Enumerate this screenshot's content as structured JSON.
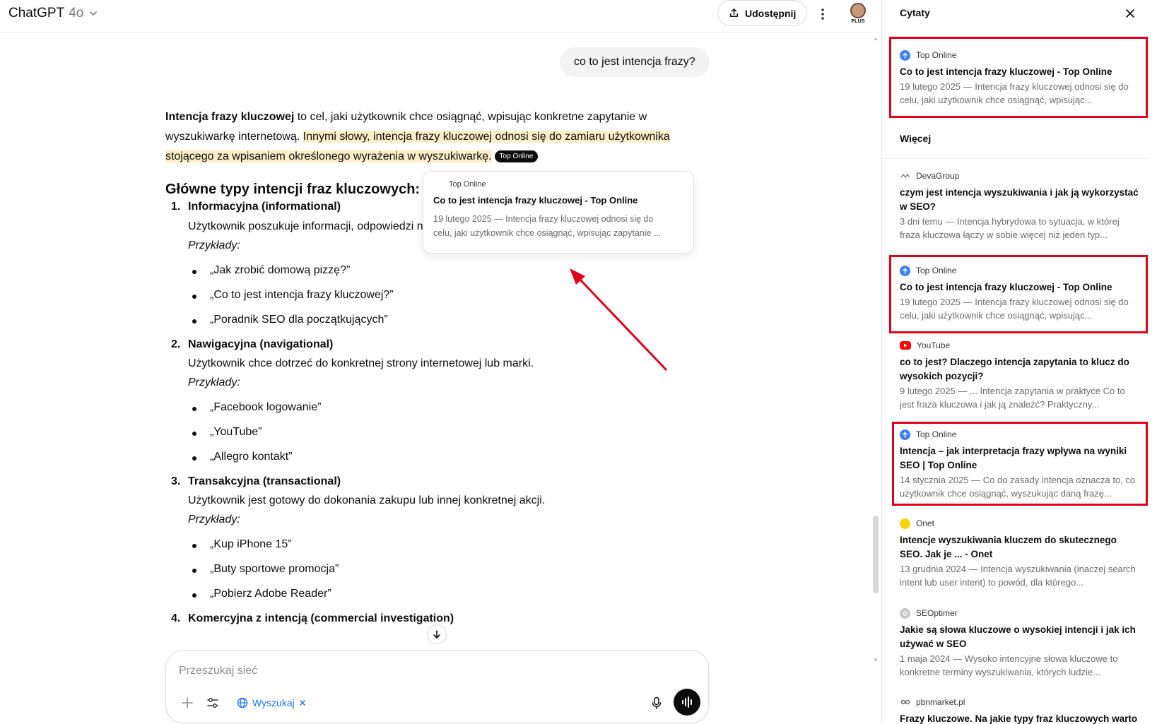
{
  "header": {
    "model_name": "ChatGPT",
    "model_version": "4o",
    "share_label": "Udostępnij",
    "avatar_badge": "PLUS"
  },
  "chat": {
    "user_message": "co to jest intencja frazy?",
    "intro_bold": "Intencja frazy kluczowej",
    "intro_rest": " to cel, jaki użytkownik chce osiągnąć, wpisując konkretne zapytanie w wyszukiwarkę internetową. ",
    "intro_highlight": "Innymi słowy, intencja frazy kluczowej odnosi się do zamiaru użytkownika stojącego za wpisaniem określonego wyrażenia w wyszukiwarkę.",
    "cite_pill": "Top Online",
    "section_title": "Główne typy intencji fraz kluczowych:",
    "examples_label": "Przykłady:",
    "items": [
      {
        "num": "1.",
        "title": "Informacyjna (informational)",
        "desc": "Użytkownik poszukuje informacji, odpowiedzi n",
        "examples": [
          "„Jak zrobić domową pizzę?”",
          "„Co to jest intencja frazy kluczowej?”",
          "„Poradnik SEO dla początkujących”"
        ]
      },
      {
        "num": "2.",
        "title": "Nawigacyjna (navigational)",
        "desc": "Użytkownik chce dotrzeć do konkretnej strony internetowej lub marki.",
        "examples": [
          "„Facebook logowanie”",
          "„YouTube”",
          "„Allegro kontakt”"
        ]
      },
      {
        "num": "3.",
        "title": "Transakcyjna (transactional)",
        "desc": "Użytkownik jest gotowy do dokonania zakupu lub innej konkretnej akcji.",
        "examples": [
          "„Kup iPhone 15”",
          "„Buty sportowe promocja”",
          "„Pobierz Adobe Reader”"
        ]
      },
      {
        "num": "4.",
        "title": "Komercyjna z intencją (commercial investigation)",
        "desc": "",
        "examples": []
      }
    ]
  },
  "popup": {
    "source": "Top Online",
    "title": "Co to jest intencja frazy kluczowej - Top Online",
    "snippet_line1": "19 lutego 2025 — Intencja frazy kluczowej odnosi się do",
    "snippet_line2": "celu, jaki użytkownik chce osiągnąć, wpisując zapytanie ..."
  },
  "composer": {
    "placeholder": "Przeszukaj sieć",
    "search_label": "Wyszukaj"
  },
  "sidebar": {
    "title": "Cytaty",
    "more_label": "Więcej",
    "citations": [
      {
        "source": "Top Online",
        "icon": "top-online-icon",
        "title": "Co to jest intencja frazy kluczowej - Top Online",
        "snippet": "19 lutego 2025 — Intencja frazy kluczowej odnosi się do celu, jaki użytkownik chce osiągnąć, wpisując..."
      },
      {
        "source": "DevaGroup",
        "icon": "devagroup-icon",
        "title": "czym jest intencja wyszukiwania i jak ją wykorzystać w SEO?",
        "snippet": "3 dni temu — Intencja hybrydowa to sytuacja, w której fraza kluczowa łączy w sobie więcej niż jeden typ..."
      },
      {
        "source": "Top Online",
        "icon": "top-online-icon",
        "title": "Co to jest intencja frazy kluczowej - Top Online",
        "snippet": "19 lutego 2025 — Intencja frazy kluczowej odnosi się do celu, jaki użytkownik chce osiągnąć, wpisując..."
      },
      {
        "source": "YouTube",
        "icon": "youtube-icon",
        "title": "co to jest? Dlaczego intencja zapytania to klucz do wysokich pozycji?",
        "snippet": "9 lutego 2025 — ... Intencja zapytania w praktyce Co to jest fraza kluczowa i jak ją znaleźć? Praktyczny..."
      },
      {
        "source": "Top Online",
        "icon": "top-online-icon",
        "title": "Intencja – jak interpretacja frazy wpływa na wyniki SEO | Top Online",
        "snippet": "14 stycznia 2025 — Co do zasady intencja oznacza to, co użytkownik chce osiągnąć, wyszukując daną frazę..."
      },
      {
        "source": "Onet",
        "icon": "onet-icon",
        "title": "Intencje wyszukiwania kluczem do skutecznego SEO. Jak je ... - Onet",
        "snippet": "13 grudnia 2024 — Intencja wyszukiwania (inaczej search intent lub user intent) to powód, dla którego..."
      },
      {
        "source": "SEOptimer",
        "icon": "seoptimer-icon",
        "title": "Jakie są słowa kluczowe o wysokiej intencji i jak ich używać w SEO",
        "snippet": "1 maja 2024 — Wysoko intencyjne słowa kluczowe to konkretne terminy wyszukiwania, których ludzie..."
      },
      {
        "source": "pbnmarket.pl",
        "icon": "pbnmarket-icon",
        "title": "Frazy kluczowe. Na jakie typy fraz kluczowych warto",
        "snippet": ""
      }
    ]
  },
  "colors": {
    "highlight": "#fdeec7",
    "annotation_red": "#e0001b",
    "link_blue": "#1a73e8"
  }
}
